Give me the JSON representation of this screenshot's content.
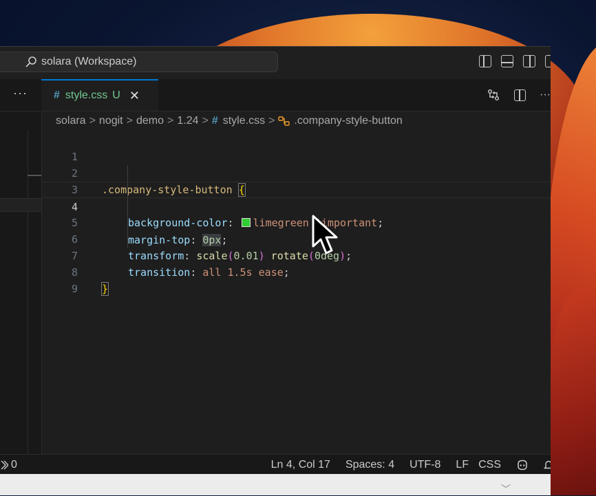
{
  "titlebar": {
    "search_text": "solara (Workspace)"
  },
  "tabs": {
    "more": "···",
    "active": {
      "hash": "#",
      "name": "style.css",
      "status": "U",
      "close": "✕"
    }
  },
  "breadcrumb": {
    "items": [
      "solara",
      "nogit",
      "demo",
      "1.24"
    ],
    "sep": ">",
    "file_hash": "#",
    "file": "style.css",
    "symbol_icon": "symbol-class-icon",
    "symbol": ".company-style-button"
  },
  "editor": {
    "line_numbers": [
      "1",
      "2",
      "3",
      "4",
      "5",
      "6",
      "7",
      "8",
      "9"
    ],
    "active_line": "4",
    "l2": {
      "selector": ".company-style-button ",
      "brace": "{"
    },
    "l3": {
      "prop": "background-color",
      "colon": ": ",
      "value": "limegreen !important",
      "semi": ";"
    },
    "l4": {
      "prop": "margin-top",
      "colon": ": ",
      "value": "0px",
      "semi": ";"
    },
    "l5": {
      "prop": "transform",
      "colon": ": ",
      "fn1": "scale",
      "p1o": "(",
      "n1": "0.01",
      "p1c": ")",
      "sp": " ",
      "fn2": "rotate",
      "p2o": "(",
      "n2": "0deg",
      "p2c": ")",
      "semi": ";"
    },
    "l6": {
      "prop": "transition",
      "colon": ": ",
      "value": "all 1.5s ease",
      "semi": ";"
    },
    "l8": {
      "brace": "}"
    }
  },
  "statusbar": {
    "left": "0",
    "ln_col": "Ln 4, Col 17",
    "spaces": "Spaces: 4",
    "encoding": "UTF-8",
    "eol": "LF",
    "language": "CSS"
  },
  "colors": {
    "swatch": "#32cd32",
    "accent": "#0078d4"
  }
}
